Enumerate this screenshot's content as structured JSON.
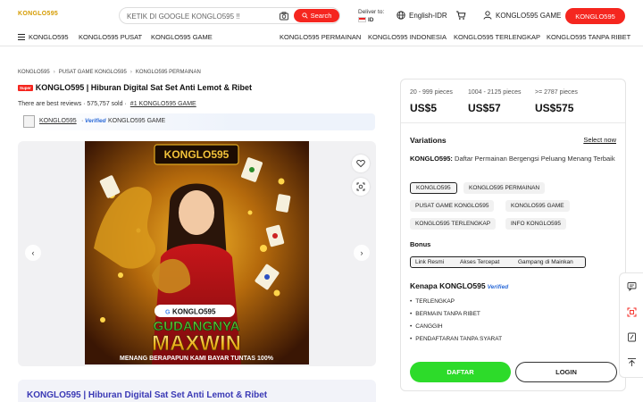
{
  "header": {
    "logo": "KONGLO595",
    "search_placeholder": "KETIK DI GOOGLE KONGLO595 !!",
    "search_button": "Search",
    "deliver_label": "Deliver to:",
    "deliver_country": "ID",
    "language": "English-IDR",
    "account": "KONGLO595 GAME",
    "register_button": "KONGLO595"
  },
  "nav": {
    "items": [
      "KONGLO595",
      "KONGLO595 PUSAT",
      "KONGLO595 GAME",
      "KONGLO595 PERMAINAN",
      "KONGLO595 INDONESIA",
      "KONGLO595 TERLENGKAP",
      "KONGLO595 TANPA RIBET"
    ]
  },
  "breadcrumb": [
    "KONGLO595",
    "PUSAT GAME KONGLO595",
    "KONGLO595 PERMAINAN"
  ],
  "product": {
    "badge": "Super",
    "title": "KONGLO595 | Hiburan Digital Sat Set Anti Lemot & Ribet",
    "reviews_text": "There are best reviews · 575,757 sold ·",
    "rank": "#1 KONGLO595 GAME",
    "store_name": "KONGLO595",
    "verified": "Verified",
    "store_game": "KONGLO595 GAME"
  },
  "image": {
    "brand": "KONGLO595",
    "search_pill": "KONGLO595",
    "headline1": "GUDANGNYA",
    "headline2": "MAXWIN",
    "tagline": "MENANG BERAPAPUN KAMI BAYAR TUNTAS 100%"
  },
  "bottom_title": "KONGLO595 | Hiburan Digital Sat Set Anti Lemot & Ribet",
  "pricing": {
    "tiers": [
      {
        "qty": "20 - 999 pieces",
        "price": "US$5"
      },
      {
        "qty": "1004 - 2125 pieces",
        "price": "US$57"
      },
      {
        "qty": ">= 2787 pieces",
        "price": "US$575"
      }
    ]
  },
  "variations": {
    "heading": "Variations",
    "select_now": "Select now",
    "desc_bold": "KONGLO595:",
    "desc_text": "Daftar Permainan Bergengsi Peluang Menang Terbaik",
    "chips": [
      "KONGLO595",
      "KONGLO595 PERMAINAN",
      "PUSAT GAME KONGLO595",
      "KONGLO595 GAME",
      "KONGLO595 TERLENGKAP",
      "INFO KONGLO595"
    ]
  },
  "bonus": {
    "heading": "Bonus",
    "items": [
      "Link Resmi",
      "Akses Tercepat",
      "Gampang di Mainkan"
    ]
  },
  "why": {
    "heading": "Kenapa KONGLO595",
    "verified": "Verified",
    "items": [
      "TERLENGKAP",
      "BERMAIN TANPA RIBET",
      "CANGGIH",
      "PENDAFTARAN TANPA SYARAT"
    ]
  },
  "actions": {
    "daftar": "DAFTAR",
    "login": "LOGIN"
  },
  "colors": {
    "brand_red": "#f5261f",
    "daftar_green": "#2ddb2a",
    "title_blue": "#3a39b5"
  }
}
